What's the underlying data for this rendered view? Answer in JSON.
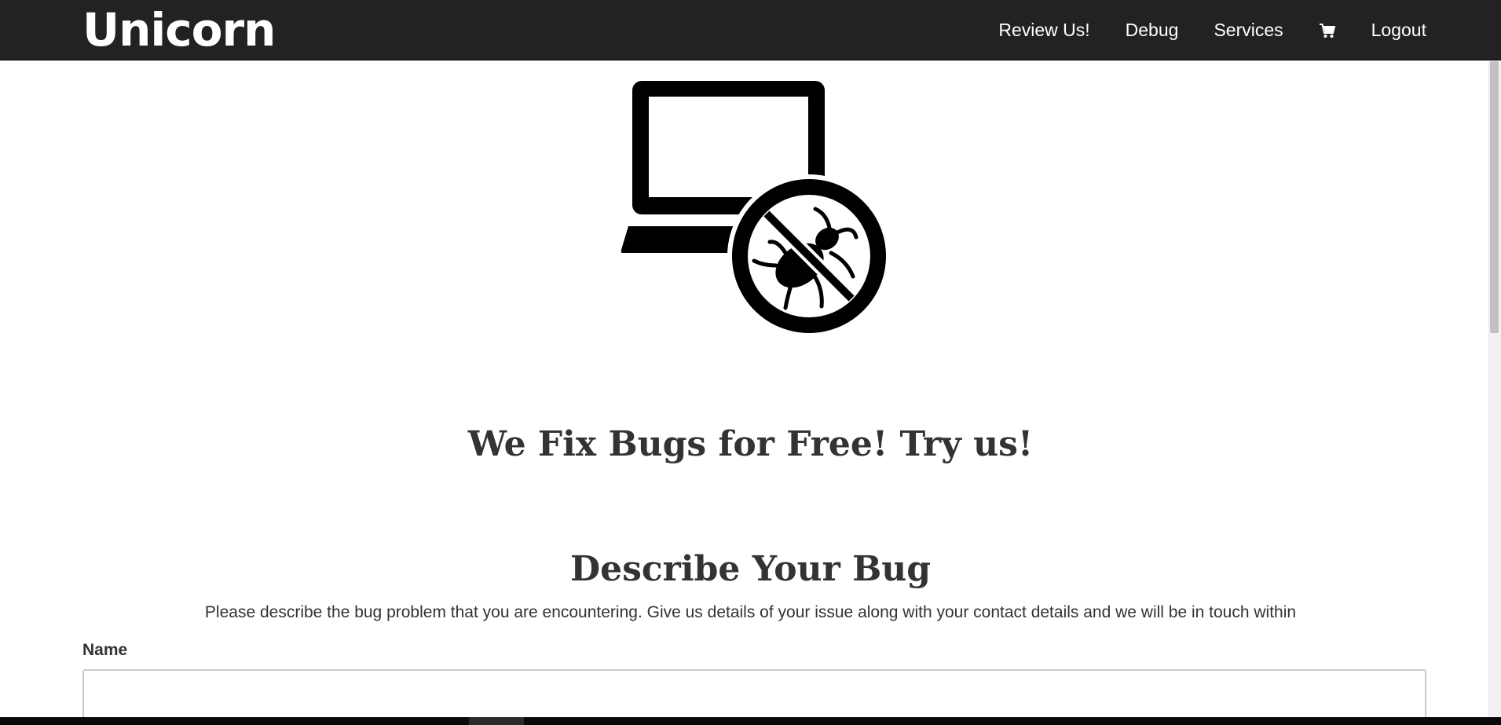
{
  "navbar": {
    "brand": "Unicorn",
    "links": {
      "review": "Review Us!",
      "debug": "Debug",
      "services": "Services",
      "logout": "Logout"
    },
    "cart_icon": "shopping-cart-icon"
  },
  "hero": {
    "icon": "laptop-no-bugs-icon",
    "headline": "We Fix Bugs for Free! Try us!"
  },
  "bug_form": {
    "title": "Describe Your Bug",
    "intro": "Please describe the bug problem that you are encountering. Give us details of your issue along with your contact details and we will be in touch within",
    "name_label": "Name",
    "name_value": "",
    "name_placeholder": ""
  },
  "colors": {
    "navbar_bg": "#222222",
    "text": "#333333",
    "input_border": "#cccccc"
  }
}
